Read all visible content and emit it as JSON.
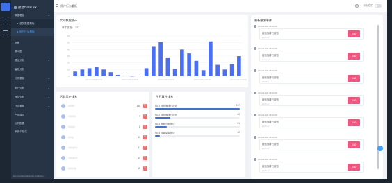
{
  "sidebar": {
    "brand": "聚达DataLink",
    "items": [
      {
        "label": "数据看板",
        "has_children": true
      },
      {
        "label": "总览数据看板",
        "sub": true
      },
      {
        "label": "用户行为看板",
        "sub": true,
        "active": true
      },
      {
        "label": "趋势"
      },
      {
        "label": "漏斗图"
      },
      {
        "label": "路径分析",
        "has_children": true
      },
      {
        "label": "留存分析"
      },
      {
        "label": "分布看板",
        "has_children": true
      },
      {
        "label": "用户分析",
        "has_children": true
      },
      {
        "label": "埋点分析",
        "has_children": true
      },
      {
        "label": "日志看板",
        "has_children": true
      },
      {
        "label": "产品建议"
      },
      {
        "label": "公共配置"
      },
      {
        "label": "系统个性化"
      }
    ],
    "footer_url": "https://tsuhdkfvisadkadinbx.html#/data-b"
  },
  "topbar": {
    "breadcrumb": "用户行为看板",
    "right_label": "深色模式"
  },
  "chart_card": {
    "title": "实时数据统计",
    "subtitle_label": "事件总数：",
    "subtitle_value": "337"
  },
  "chart_data": {
    "type": "bar",
    "x": [
      "",
      "",
      "",
      "",
      "",
      "",
      "",
      "",
      "",
      "",
      "",
      "",
      "",
      "",
      "",
      "",
      "",
      "",
      "",
      "",
      "",
      "",
      "",
      ""
    ],
    "values": [
      7,
      10,
      12,
      14,
      10,
      6,
      2,
      1,
      0,
      1,
      12,
      44,
      51,
      28,
      11,
      40,
      34,
      23,
      9,
      52,
      17,
      10,
      18,
      30
    ],
    "ylim": [
      0,
      60
    ],
    "yticks": [
      "60",
      "50",
      "40",
      "30",
      "20",
      "10",
      "0"
    ],
    "xtick_labels": [
      "2023-04-08 08:00:00",
      "2023-04-08 09:00:00",
      "2023-04-08 10:00:00",
      "2023-04-08 12:00:00",
      "2023-04-08 14:00:00"
    ],
    "color": "#4a6ff0"
  },
  "top_users": {
    "title": "活跃用户排名",
    "rows": [
      {
        "name": "admin",
        "count": "155"
      },
      {
        "name": "hdhdhd",
        "count": "7"
      },
      {
        "name": "shaozi",
        "count": "8"
      },
      {
        "name": "deng",
        "count": "11"
      },
      {
        "name": "xiaoqinzi",
        "count": "11"
      },
      {
        "name": "xiaoqinzi",
        "count": "14"
      },
      {
        "name": "jiaoxing",
        "count": "15"
      }
    ]
  },
  "events_rank": {
    "title": "今日事件排名",
    "rows": [
      {
        "rank": "No.1",
        "name": "经验值排行按钮",
        "value": "217",
        "pct": 1.0
      },
      {
        "rank": "No.2",
        "name": "经验值排行按钮",
        "value": "40",
        "pct": 0.18
      },
      {
        "rank": "No.3",
        "name": "数据分析按钮",
        "value": "31",
        "pct": 0.14
      },
      {
        "rank": "No.4",
        "name": "设置菜单按钮",
        "value": "12",
        "pct": 0.06
      }
    ]
  },
  "recent_events": {
    "title": "最新触发事件",
    "items": [
      {
        "time": "2023-04-08 15:20:08",
        "title": "经验值排行按钮",
        "user": "aQQmY",
        "amount": "3.00"
      },
      {
        "time": "2023-04-08 15:20:08",
        "title": "经验值排行按钮",
        "user": "xiaoqinzi",
        "amount": "3.00"
      },
      {
        "time": "2023-04-08 15:20:08",
        "title": "经验值排行按钮",
        "user": "hdhdhd",
        "amount": "3.00"
      },
      {
        "time": "2023-04-08 15:20:08",
        "title": "经验值排行按钮",
        "user": "aQQmY",
        "amount": "3.00"
      },
      {
        "time": "2023-04-08 15:20:08",
        "title": "经验值排行按钮",
        "user": "aQQmY",
        "amount": "3.00"
      },
      {
        "time": "2023-04-08 15:20:08",
        "title": "经验值排行按钮",
        "user": "aQQmY",
        "amount": "3.00"
      },
      {
        "time": "2023-04-08 15:20:08",
        "title": "经验值排行按钮",
        "user": "aQQmY",
        "amount": "3.00"
      }
    ]
  },
  "icons": [
    "monitor-icon",
    "printer-icon",
    "database-icon",
    "grid-icon",
    "refresh-icon",
    "chevron-down-icon"
  ]
}
